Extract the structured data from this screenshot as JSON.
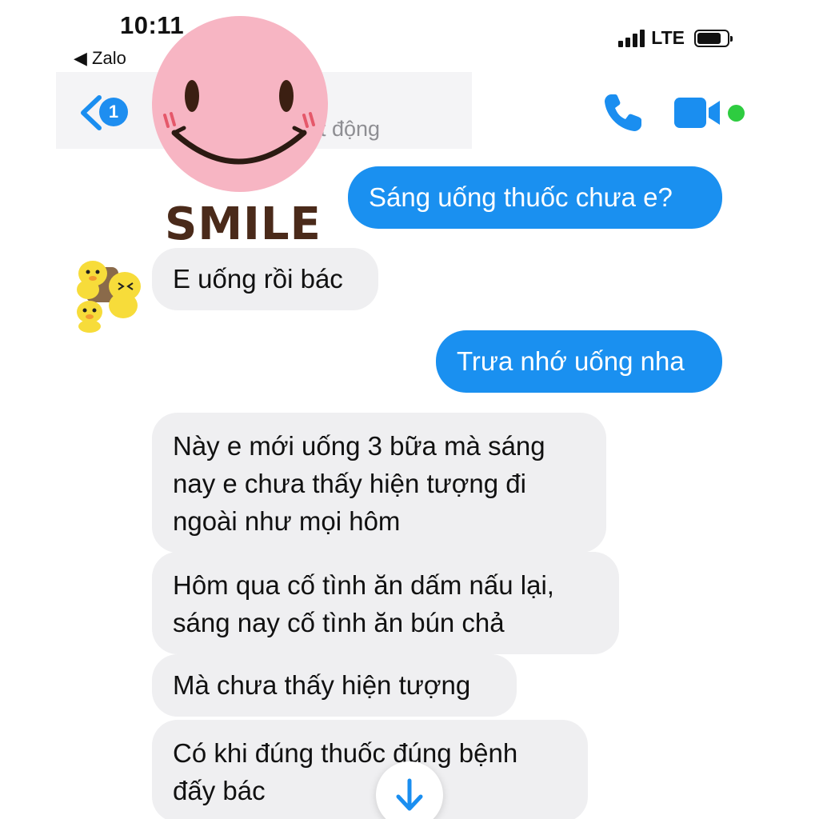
{
  "status_bar": {
    "time": "10:11",
    "back_app": "◀ Zalo",
    "network": "LTE"
  },
  "header": {
    "unread_count": "1",
    "subtitle": "t động",
    "sticker_caption": "SMILE"
  },
  "messages": [
    {
      "direction": "out",
      "text": "Sáng uống thuốc chưa e?"
    },
    {
      "direction": "in",
      "text": "E uống rồi bác"
    },
    {
      "direction": "out",
      "text": "Trưa nhớ uống nha"
    },
    {
      "direction": "in",
      "text": "Này e mới uống 3 bữa mà sáng nay e chưa thấy hiện tượng đi ngoài như mọi hôm"
    },
    {
      "direction": "in",
      "text": "Hôm qua cố tình ăn dấm nấu lại, sáng nay cố tình ăn bún chả"
    },
    {
      "direction": "in",
      "text": "Mà chưa thấy hiện tượng"
    },
    {
      "direction": "in",
      "text": "Có khi đúng thuốc đúng bệnh đấy bác"
    }
  ],
  "colors": {
    "accent": "#1a90f0",
    "incoming_bubble": "#efeff1",
    "online": "#2ecc40"
  },
  "icons": [
    "back-chevron-icon",
    "phone-icon",
    "video-camera-icon",
    "arrow-down-icon",
    "smiley-sticker-icon",
    "duck-avatar-icon"
  ]
}
